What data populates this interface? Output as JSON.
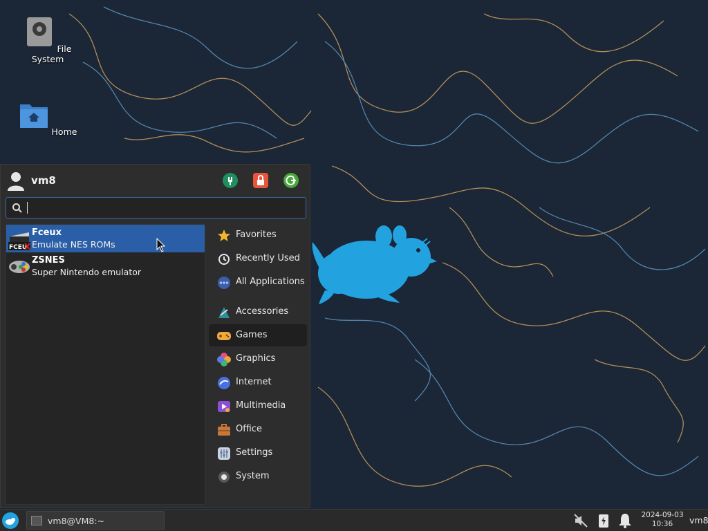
{
  "desktop": {
    "icons": [
      {
        "label": "File System",
        "icon": "drive-icon"
      },
      {
        "label": "Home",
        "icon": "home-folder-icon"
      }
    ]
  },
  "menu": {
    "username": "vm8",
    "header_buttons": [
      "settings-icon",
      "lock-icon",
      "logout-icon"
    ],
    "search": {
      "value": "",
      "placeholder": ""
    },
    "apps": [
      {
        "name": "Fceux",
        "description": "Emulate NES ROMs",
        "selected": true
      },
      {
        "name": "ZSNES",
        "description": "Super Nintendo emulator",
        "selected": false
      }
    ],
    "categories": [
      {
        "label": "Favorites",
        "icon": "star-icon"
      },
      {
        "label": "Recently Used",
        "icon": "clock-icon"
      },
      {
        "label": "All Applications",
        "icon": "dots-icon"
      },
      {
        "label": "Accessories",
        "icon": "accessories-icon"
      },
      {
        "label": "Games",
        "icon": "gamepad-icon",
        "active": true
      },
      {
        "label": "Graphics",
        "icon": "graphics-icon"
      },
      {
        "label": "Internet",
        "icon": "globe-icon"
      },
      {
        "label": "Multimedia",
        "icon": "multimedia-icon"
      },
      {
        "label": "Office",
        "icon": "briefcase-icon"
      },
      {
        "label": "Settings",
        "icon": "settings-icon"
      },
      {
        "label": "System",
        "icon": "system-icon"
      }
    ]
  },
  "taskbar": {
    "task_label": "vm8@VM8:~",
    "date": "2024-09-03",
    "time": "10:36",
    "user": "vm8"
  },
  "colors": {
    "wallpaper": "#1b2636",
    "xfce_mouse": "#23a2e0",
    "selection": "#2a5fa8",
    "menu_bg": "#2d2d2d"
  }
}
